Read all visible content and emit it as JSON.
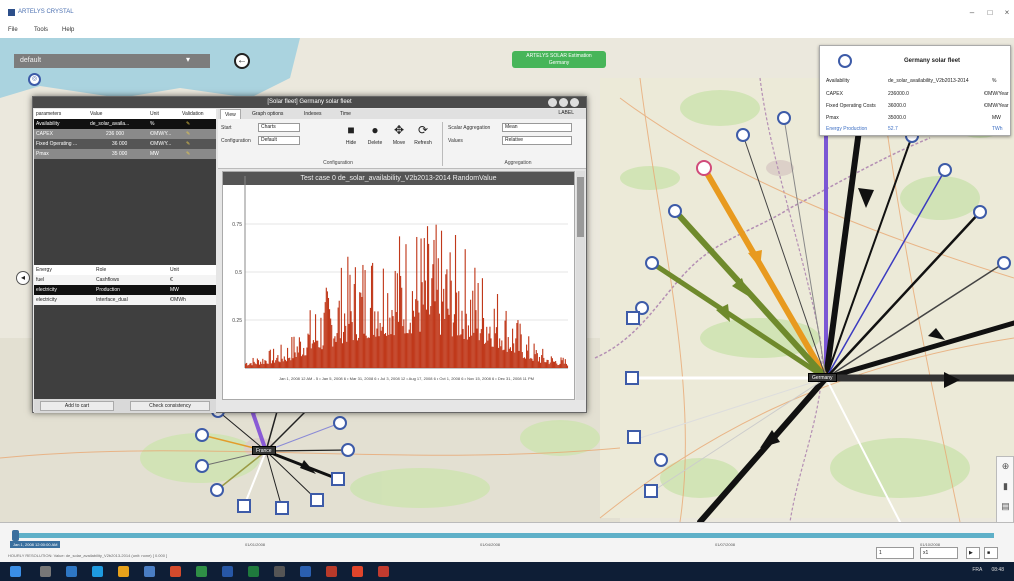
{
  "window": {
    "title": "ARTELYS CRYSTAL",
    "menu": [
      "File",
      "Tools",
      "Help"
    ]
  },
  "map": {
    "top_bar_text": "default",
    "green_badge_line1": "ARTELYS SOLAR Estimation",
    "green_badge_line2": "Germany",
    "hub_labels": [
      "Germany",
      "France"
    ]
  },
  "info_card": {
    "title": "Germany solar fleet",
    "rows": [
      {
        "label": "Availability",
        "value": "de_solar_availability_V2b2013-2014",
        "unit": "%"
      },
      {
        "label": "CAPEX",
        "value": "236000.0",
        "unit": "€/MW/Year"
      },
      {
        "label": "Fixed Operating Costs",
        "value": "36000.0",
        "unit": "€/MW/Year"
      },
      {
        "label": "Pmax",
        "value": "35000.0",
        "unit": "MW"
      },
      {
        "label": "Energy Production",
        "value": "52.7",
        "unit": "TWh"
      }
    ]
  },
  "floating_window": {
    "title": "[Solar fleet] Germany solar fleet",
    "params_headers": [
      "parameters",
      "Value",
      "Unit",
      "Validation"
    ],
    "params_rows": [
      {
        "name": "Availability",
        "value": "de_solar_availa...",
        "unit": "%"
      },
      {
        "name": "CAPEX",
        "value": "236 000",
        "unit": "€/MW/Y..."
      },
      {
        "name": "Fixed Operating ...",
        "value": "36 000",
        "unit": "€/MW/Y..."
      },
      {
        "name": "Pmax",
        "value": "35 000",
        "unit": "MW"
      }
    ],
    "energy_headers": [
      "Energy",
      "Role",
      "Unit"
    ],
    "energy_rows": [
      {
        "energy": "fuel",
        "role": "Cashflows",
        "unit": "€"
      },
      {
        "energy": "electricity",
        "role": "Production",
        "unit": "MW"
      },
      {
        "energy": "electricity",
        "role": "Interface_dual",
        "unit": "€/MWh"
      }
    ],
    "add_to_cart": "Add to cart",
    "check_consistency": "Check consistency",
    "tabs": [
      "View",
      "Graph options",
      "Indexes",
      "Time"
    ],
    "tabs_right_label": "LABEL",
    "ribbon": {
      "start_label": "Start",
      "start_value": "Charts",
      "config_label": "Configuration",
      "config_value": "Default",
      "buttons": [
        "Hide",
        "Delete",
        "Move",
        "Refresh"
      ],
      "config_caption": "Configuration",
      "sorted_agg_label": "Scalar Aggregation",
      "sorted_agg_value": "Mean",
      "values_label": "Values",
      "values_value": "Relative",
      "agg_caption": "Aggregation"
    }
  },
  "chart_data": {
    "type": "bar",
    "title": "Test case 0 de_solar_availability_V2b2013-2014 RandomValue",
    "ylim": [
      0,
      1
    ],
    "y_ticks": [
      "0.75",
      "0.5",
      "0.25"
    ],
    "x_tick_labels": "Jan 1, 2008 12 AM - 5 • Jan 5, 2008 6 • Mar 31, 2008 6 • Jul 3, 2008 12 • Aug 17, 2008 6 • Oct 1, 2008 6 • Nov 15, 2008 6 • Dec 31, 2008 11 PM",
    "color": "#c0391b",
    "envelope_values": [
      0.05,
      0.06,
      0.08,
      0.1,
      0.12,
      0.18,
      0.25,
      0.32,
      0.38,
      0.45,
      0.52,
      0.55,
      0.6,
      0.64,
      0.66,
      0.68,
      0.7,
      0.72,
      0.72,
      0.7,
      0.68,
      0.66,
      0.62,
      0.58,
      0.52,
      0.46,
      0.4,
      0.32,
      0.24,
      0.16,
      0.11,
      0.08,
      0.06,
      0.05
    ]
  },
  "timeline": {
    "date_label": "Jan 1, 2008 12:00:00 AM",
    "axis_labels": [
      "01/01/2008",
      "01/04/2008",
      "01/07/2008",
      "01/10/2008"
    ],
    "status_text": "HOURLY RESOLUTION: Value: de_solar_availability_V2b2013-2014 (unit: none) [ 0.000 ]",
    "zoom_value": "1",
    "speed_value": "x1"
  },
  "taskbar": {
    "time": "08:48",
    "lang": "FRA"
  }
}
